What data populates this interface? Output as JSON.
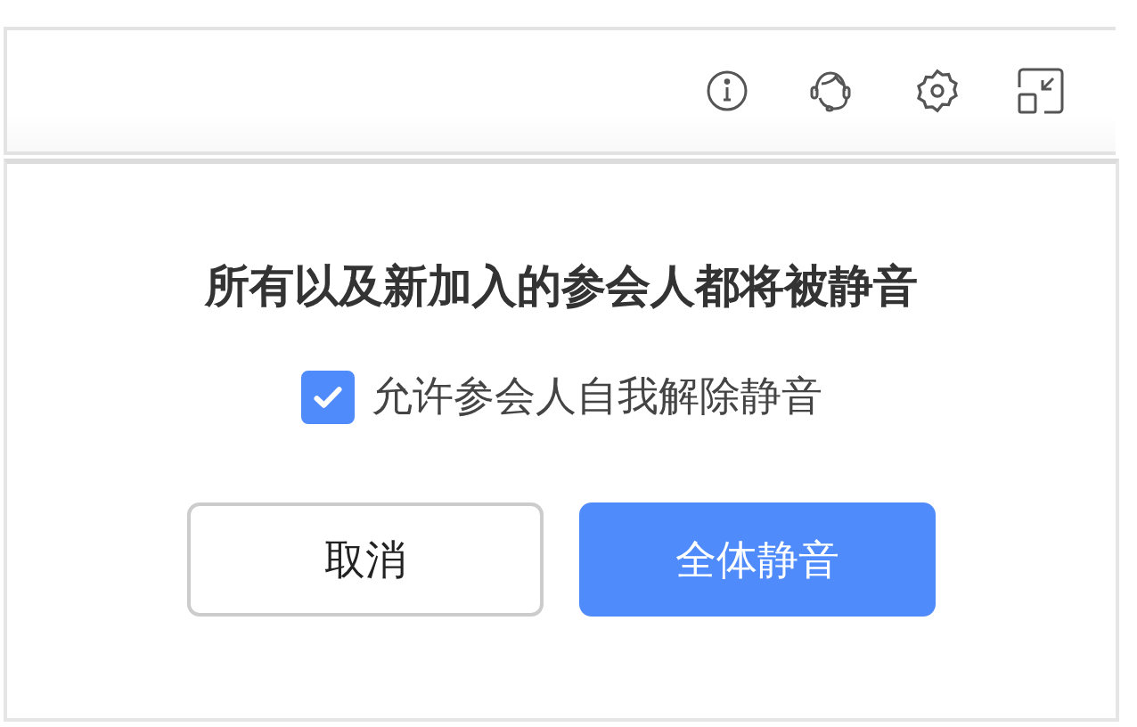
{
  "dialog": {
    "message": "所有以及新加入的参会人都将被静音",
    "allow_unmute": {
      "label": "允许参会人自我解除静音",
      "checked": true
    },
    "buttons": [
      {
        "label": "取消",
        "kind": "secondary"
      },
      {
        "label": "全体静音",
        "kind": "primary"
      }
    ]
  }
}
